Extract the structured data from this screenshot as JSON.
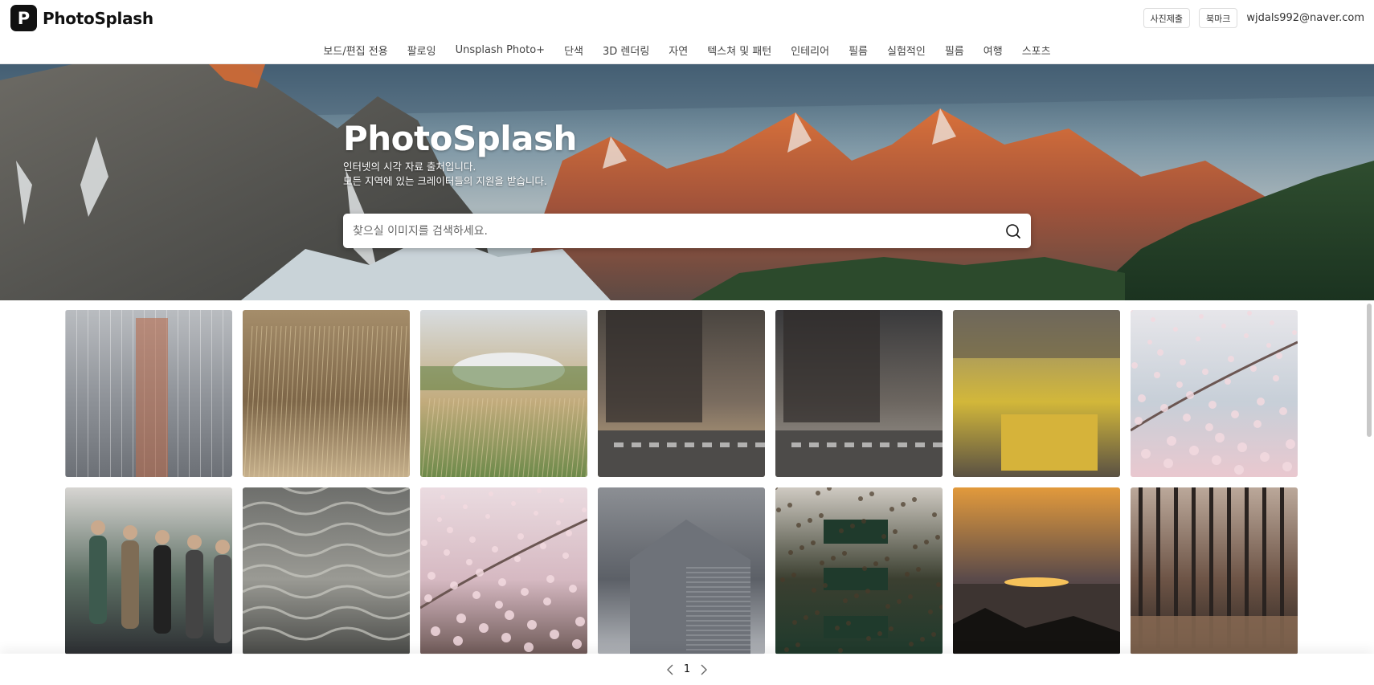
{
  "brand": {
    "logo_letter": "P",
    "name": "PhotoSplash"
  },
  "header": {
    "submit_photo": "사진제출",
    "bookmark": "북마크",
    "user_email": "wjdals992@naver.com"
  },
  "categories": [
    "보드/편집 전용",
    "팔로잉",
    "Unsplash Photo+",
    "단색",
    "3D 렌더링",
    "자연",
    "텍스쳐 및 패턴",
    "인테리어",
    "필름",
    "실험적인",
    "필름",
    "여행",
    "스포츠"
  ],
  "hero": {
    "title": "PhotoSplash",
    "subtitle_line1": "인터넷의 시각 자료 출처입니다.",
    "subtitle_line2": "모든 지역에 있는 크레이터들의 지원을 받습니다.",
    "search_placeholder": "찾으실 이미지를 검색하세요."
  },
  "photos": [
    {
      "subject": "apartment-towers",
      "colors": [
        "#b9bcc0",
        "#8d9197",
        "#6c7076"
      ]
    },
    {
      "subject": "dry-grass",
      "colors": [
        "#a58d6a",
        "#7d6648",
        "#c6b08c"
      ]
    },
    {
      "subject": "stadium-field",
      "colors": [
        "#d8dcdf",
        "#c2ab7c",
        "#6d8a4a"
      ]
    },
    {
      "subject": "street-crossing",
      "colors": [
        "#4a4540",
        "#7a6c5f",
        "#c9ae86"
      ]
    },
    {
      "subject": "narrow-alley",
      "colors": [
        "#3a3a3c",
        "#6c6660",
        "#a7a29b"
      ]
    },
    {
      "subject": "fish-market",
      "colors": [
        "#8f8776",
        "#d2b73a",
        "#5a5143"
      ]
    },
    {
      "subject": "cherry-blossom-branch",
      "colors": [
        "#e7e6ea",
        "#c7cfd8",
        "#e9c8cf"
      ]
    },
    {
      "subject": "crowd-walking",
      "colors": [
        "#d7d5d2",
        "#5c6e63",
        "#2d2f33"
      ]
    },
    {
      "subject": "roof-tiles",
      "colors": [
        "#6e6f6c",
        "#9a9a94",
        "#4a4b48"
      ]
    },
    {
      "subject": "cherry-blossoms",
      "colors": [
        "#eadbe0",
        "#d6b9c2",
        "#6f5a58"
      ]
    },
    {
      "subject": "building-corner",
      "colors": [
        "#8c8f94",
        "#5c6067",
        "#b2b5ba"
      ]
    },
    {
      "subject": "ivy-wall",
      "colors": [
        "#cfcac2",
        "#3b3f30",
        "#1f3a2c"
      ]
    },
    {
      "subject": "sunset-sea",
      "colors": [
        "#e29a3c",
        "#5a4a4a",
        "#2a2220"
      ]
    },
    {
      "subject": "autumn-forest",
      "colors": [
        "#bba89a",
        "#6d5446",
        "#2e2723"
      ]
    }
  ],
  "pagination": {
    "current_page": "1"
  },
  "theme": {
    "accent": "#111111",
    "border": "#dddddd"
  }
}
